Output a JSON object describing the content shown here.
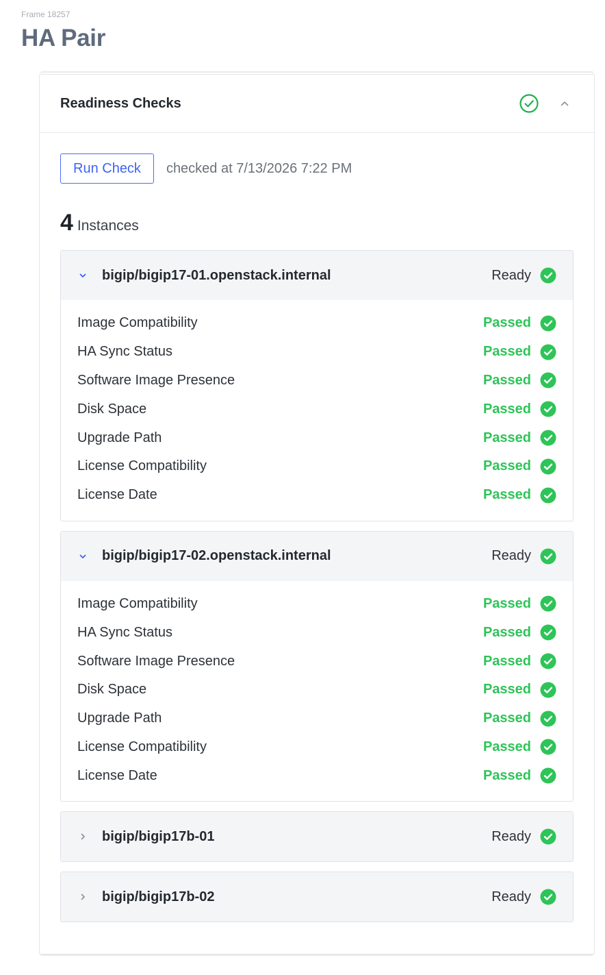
{
  "frame_label": "Frame 18257",
  "page_title": "HA Pair",
  "card": {
    "title": "Readiness Checks",
    "run_button": "Run Check",
    "checked_at": "checked at 7/13/2026 7:22 PM",
    "instance_count": "4",
    "instance_label": "Instances"
  },
  "instances": [
    {
      "name": "bigip/bigip17-01.openstack.internal",
      "status": "Ready",
      "expanded": true,
      "checks": [
        {
          "name": "Image Compatibility",
          "status": "Passed"
        },
        {
          "name": "HA Sync Status",
          "status": "Passed"
        },
        {
          "name": "Software Image Presence",
          "status": "Passed"
        },
        {
          "name": "Disk Space",
          "status": "Passed"
        },
        {
          "name": "Upgrade Path",
          "status": "Passed"
        },
        {
          "name": "License Compatibility",
          "status": "Passed"
        },
        {
          "name": "License Date",
          "status": "Passed"
        }
      ]
    },
    {
      "name": "bigip/bigip17-02.openstack.internal",
      "status": "Ready",
      "expanded": true,
      "checks": [
        {
          "name": "Image Compatibility",
          "status": "Passed"
        },
        {
          "name": "HA Sync Status",
          "status": "Passed"
        },
        {
          "name": "Software Image Presence",
          "status": "Passed"
        },
        {
          "name": "Disk Space",
          "status": "Passed"
        },
        {
          "name": "Upgrade Path",
          "status": "Passed"
        },
        {
          "name": "License Compatibility",
          "status": "Passed"
        },
        {
          "name": "License Date",
          "status": "Passed"
        }
      ]
    },
    {
      "name": "bigip/bigip17b-01",
      "status": "Ready",
      "expanded": false,
      "checks": []
    },
    {
      "name": "bigip/bigip17b-02",
      "status": "Ready",
      "expanded": false,
      "checks": []
    }
  ],
  "colors": {
    "accent": "#3f63f2",
    "success": "#2ec458",
    "title": "#5f6b7c"
  }
}
